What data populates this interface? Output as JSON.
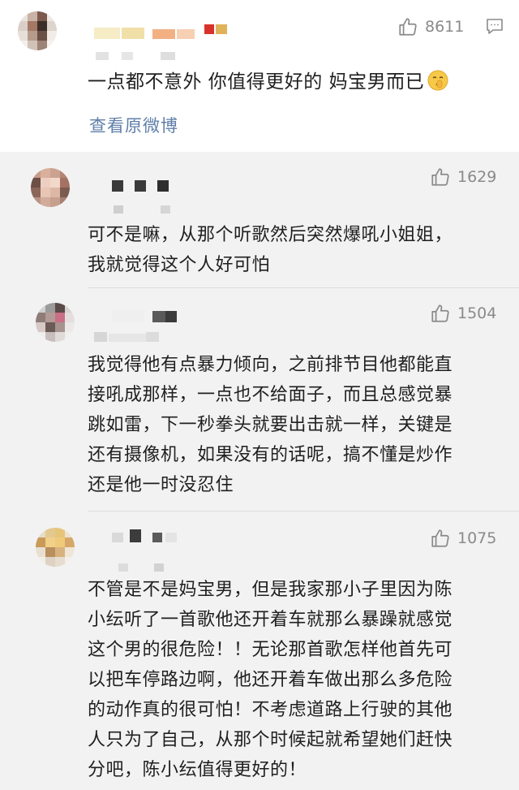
{
  "post": {
    "likes": "8611",
    "text": "一点都不意外 你值得更好的 妈宝男而已",
    "emoji": "shushing-face",
    "view_original": "查看原微博"
  },
  "replies": [
    {
      "likes": "1629",
      "lines": [
        "可不是嘛，从那个听歌然后突然爆吼小姐姐，",
        "我就觉得这个人好可怕"
      ]
    },
    {
      "likes": "1504",
      "lines": [
        "我觉得他有点暴力倾向，之前排节目他都能直",
        "接吼成那样，一点也不给面子，而且总感觉暴",
        "跳如雷，下一秒拳头就要出击就一样，关键是",
        "还有摄像机，如果没有的话呢，搞不懂是炒作",
        "还是他一时没忍住"
      ]
    },
    {
      "likes": "1075",
      "lines": [
        "不管是不是妈宝男，但是我家那小子里因为陈",
        "小纭听了一首歌他还开着车就那么暴躁就感觉",
        "这个男的很危险！！无论那首歌怎样他首先可",
        "以把车停路边啊，他还开着车做出那么多危险",
        "的动作真的很可怕！不考虑道路上行驶的其他",
        "人只为了自己，从那个时候起就希望她们赶快",
        "分吧，陈小纭值得更好的！"
      ]
    }
  ],
  "colors": {
    "link": "#5f7fa9",
    "like_gray": "#8a8a8a",
    "reply_bg": "#f2f2f2"
  }
}
